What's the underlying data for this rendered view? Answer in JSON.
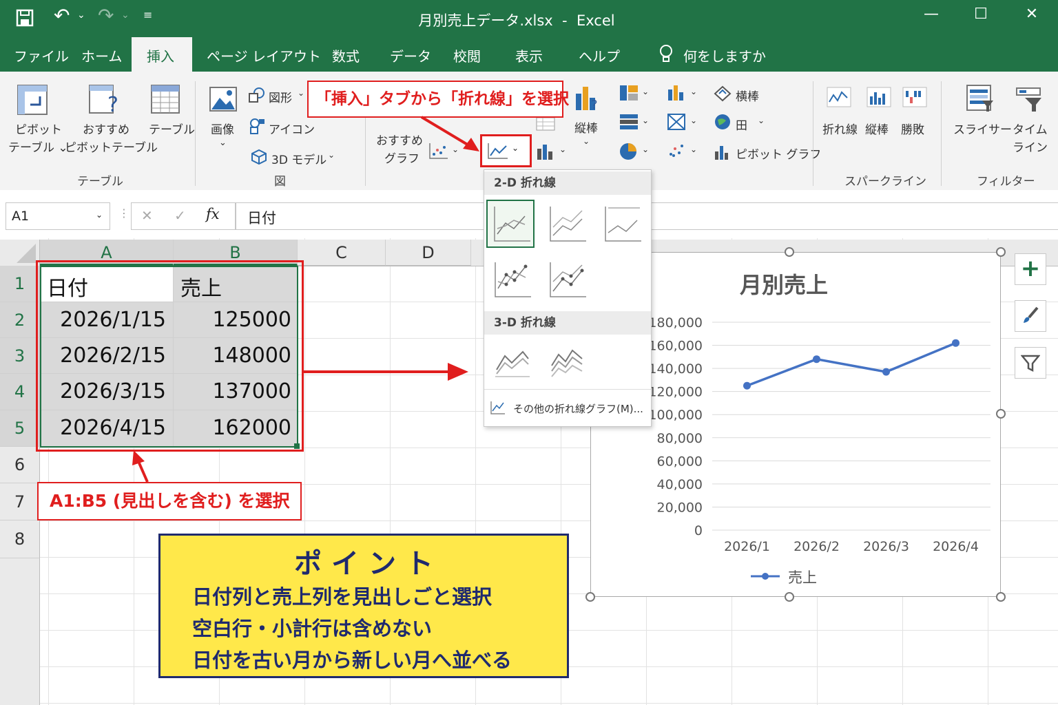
{
  "titlebar": {
    "title": "月別売上データ.xlsx  -  Excel",
    "save_icon": "floppy-disk-icon",
    "undo_label": "↶",
    "redo_label": "↷",
    "minimize": "—",
    "restore": "☐",
    "close": "✕"
  },
  "tabs": [
    {
      "label": "ファイル"
    },
    {
      "label": "ホーム"
    },
    {
      "label": "挿入",
      "active": true
    },
    {
      "label": "ページ レイアウト"
    },
    {
      "label": "数式"
    },
    {
      "label": "データ"
    },
    {
      "label": "校閲"
    },
    {
      "label": "表示"
    },
    {
      "label": "ヘルプ"
    }
  ],
  "tell_me": "何をしますか",
  "ribbon": {
    "pivot_line1": "ピボット",
    "pivot_line2": "テーブル ⌄",
    "rec_pivot_line1": "おすすめ",
    "rec_pivot_line2": "ピボットテーブル",
    "table": "テーブル",
    "group_table": "テーブル",
    "image": "画像",
    "shapes": "図形",
    "icons": "アイコン",
    "model3d": "3D モデル",
    "group_figure": "図",
    "rec_chart_line1": "おすすめ",
    "rec_chart_line2": "グラフ",
    "col_chart": "縦棒",
    "bar_chart": "横棒",
    "area": "田",
    "pivot_chart": "ピボット グラフ",
    "sparkline_line": "折れ線",
    "sparkline_col": "縦棒",
    "sparkline_wl": "勝敗",
    "group_sparkline": "スパークライン",
    "slicer": "スライサー",
    "timeline_line1": "タイム",
    "timeline_line2": "ライン",
    "group_filter": "フィルター"
  },
  "formula_bar": {
    "name_box": "A1",
    "cancel": "✕",
    "enter": "✓",
    "fx": "fx",
    "value": "日付"
  },
  "columns": [
    "A",
    "B",
    "C",
    "D"
  ],
  "rows": [
    "1",
    "2",
    "3",
    "4",
    "5",
    "6",
    "7",
    "8"
  ],
  "table": {
    "headers": [
      "日付",
      "売上"
    ],
    "data": [
      [
        "2026/1/15",
        "125000"
      ],
      [
        "2026/2/15",
        "148000"
      ],
      [
        "2026/3/15",
        "137000"
      ],
      [
        "2026/4/15",
        "162000"
      ]
    ]
  },
  "dropdown": {
    "section_2d": "2-D 折れ線",
    "section_3d": "3-D 折れ線",
    "more": "その他の折れ線グラフ(M)..."
  },
  "callouts": {
    "insert_tab": "「挿入」タブから「折れ線」を選択",
    "selection": "A1:B5 (見出しを含む) を選択"
  },
  "point": {
    "title": "ポ イ ン ト",
    "line1": "日付列と売上列を見出しごと選択",
    "line2": "空白行・小計行は含めない",
    "line3": "日付を古い月から新しい月へ並べる"
  },
  "side_buttons": {
    "add": "+",
    "style": "brush-icon",
    "filter": "filter-icon"
  },
  "chart_data": {
    "type": "line",
    "title": "月別売上",
    "categories": [
      "2026/1",
      "2026/2",
      "2026/3",
      "2026/4"
    ],
    "series": [
      {
        "name": "売上",
        "values": [
          125000,
          148000,
          137000,
          162000
        ]
      }
    ],
    "ylim": [
      0,
      180000
    ],
    "yticks": [
      "180,000",
      "160,000",
      "140,000",
      "120,000",
      "100,000",
      "80,000",
      "60,000",
      "40,000",
      "20,000",
      "0"
    ],
    "grid": true,
    "legend": "bottom",
    "color": "#4472c4"
  }
}
